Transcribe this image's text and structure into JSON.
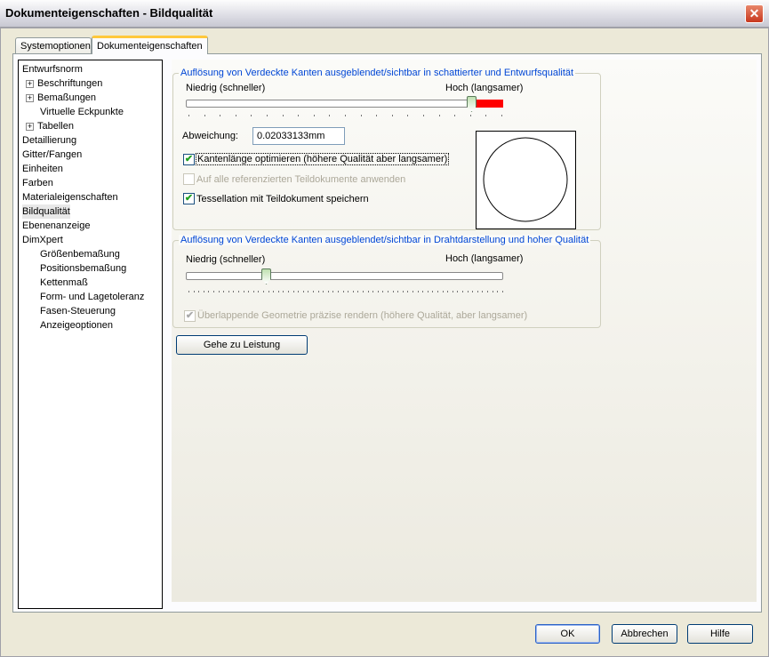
{
  "window": {
    "title": "Dokumenteigenschaften - Bildqualität",
    "close": "✕"
  },
  "tabs": [
    {
      "label": "Systemoptionen"
    },
    {
      "label": "Dokumenteigenschaften"
    }
  ],
  "tree": [
    {
      "label": "Entwurfsnorm",
      "level": 0
    },
    {
      "label": "Beschriftungen",
      "level": 1,
      "expand": true
    },
    {
      "label": "Bemaßungen",
      "level": 1,
      "expand": true
    },
    {
      "label": "Virtuelle Eckpunkte",
      "level": 1
    },
    {
      "label": "Tabellen",
      "level": 1,
      "expand": true
    },
    {
      "label": "Detaillierung",
      "level": 0
    },
    {
      "label": "Gitter/Fangen",
      "level": 0
    },
    {
      "label": "Einheiten",
      "level": 0
    },
    {
      "label": "Farben",
      "level": 0
    },
    {
      "label": "Materialeigenschaften",
      "level": 0
    },
    {
      "label": "Bildqualität",
      "level": 0,
      "selected": true
    },
    {
      "label": "Ebenenanzeige",
      "level": 0
    },
    {
      "label": "DimXpert",
      "level": 0
    },
    {
      "label": "Größenbemaßung",
      "level": 1
    },
    {
      "label": "Positionsbemaßung",
      "level": 1
    },
    {
      "label": "Kettenmaß",
      "level": 1
    },
    {
      "label": "Form- und Lagetoleranz",
      "level": 1
    },
    {
      "label": "Fasen-Steuerung",
      "level": 1
    },
    {
      "label": "Anzeigeoptionen",
      "level": 1
    }
  ],
  "group1": {
    "title": "Auflösung von Verdeckte Kanten ausgeblendet/sichtbar in schattierter und Entwurfsqualität",
    "low": "Niedrig (schneller)",
    "high": "Hoch (langsamer)",
    "slider_value": 0.93,
    "deviation_label": "Abweichung:",
    "deviation_value": "0.02033133mm",
    "cb1": "Kantenlänge optimieren (höhere Qualität aber langsamer)",
    "cb2": "Auf alle referenzierten Teildokumente anwenden",
    "cb3": "Tessellation mit Teildokument speichern"
  },
  "group2": {
    "title": "Auflösung von Verdeckte Kanten ausgeblendet/sichtbar in Drahtdarstellung und hoher Qualität",
    "low": "Niedrig (schneller)",
    "high": "Hoch (langsamer)",
    "slider_value": 0.25,
    "cb": "Überlappende Geometrie präzise rendern (höhere Qualität, aber langsamer)"
  },
  "perf_button": "Gehe zu Leistung",
  "buttons": {
    "ok": "OK",
    "cancel": "Abbrechen",
    "help": "Hilfe"
  }
}
